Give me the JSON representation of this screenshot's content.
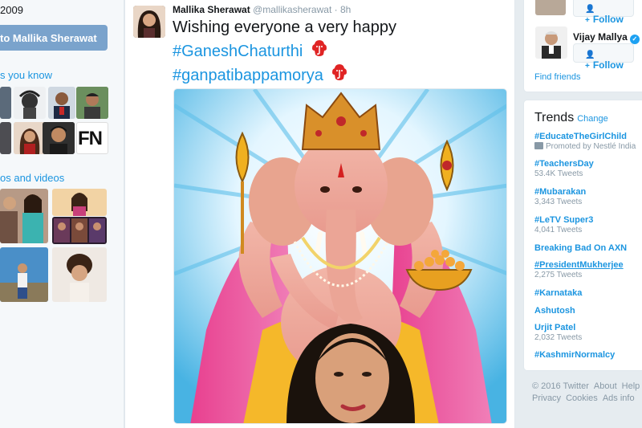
{
  "left": {
    "joined": "2009",
    "tweet_to_button": "to Mallika Sherawat",
    "people_you_know_title": "s you know",
    "photos_videos_title": "os and videos",
    "fn_badge": "FN"
  },
  "tweet": {
    "author_name": "Mallika Sherawat",
    "author_handle": "@mallikasherawat",
    "dot": "·",
    "time": "8h",
    "text_line1": "Wishing everyone a very happy",
    "hashtag1": "#GaneshChaturthi",
    "hashtag2": "#ganpatibappamorya"
  },
  "who_to_follow": {
    "follow_label": "Follow",
    "suggested_name": "Vijay Mallya",
    "find_friends": "Find friends"
  },
  "trends": {
    "title": "Trends",
    "change": "Change",
    "items": [
      {
        "name": "#EducateTheGirlChild",
        "meta": "Promoted by Nestlé India"
      },
      {
        "name": "#TeachersDay",
        "meta": "53.4K Tweets"
      },
      {
        "name": "#Mubarakan",
        "meta": "3,343 Tweets"
      },
      {
        "name": "#LeTV Super3",
        "meta": "4,041 Tweets"
      },
      {
        "name": "Breaking Bad On AXN",
        "meta": ""
      },
      {
        "name": "#PresidentMukherjee",
        "meta": "2,275 Tweets"
      },
      {
        "name": "#Karnataka",
        "meta": ""
      },
      {
        "name": "Ashutosh",
        "meta": ""
      },
      {
        "name": "Urjit Patel",
        "meta": "2,032 Tweets"
      },
      {
        "name": "#KashmirNormalcy",
        "meta": ""
      }
    ]
  },
  "footer": {
    "copyright": "© 2016 Twitter",
    "about": "About",
    "help": "Help",
    "privacy": "Privacy",
    "cookies": "Cookies",
    "ads_info": "Ads info"
  },
  "colors": {
    "link_blue": "#1b95e0",
    "muted_grey": "#8899a6",
    "page_bg": "#e6ecf0",
    "button_blue": "#7aa3cc"
  }
}
